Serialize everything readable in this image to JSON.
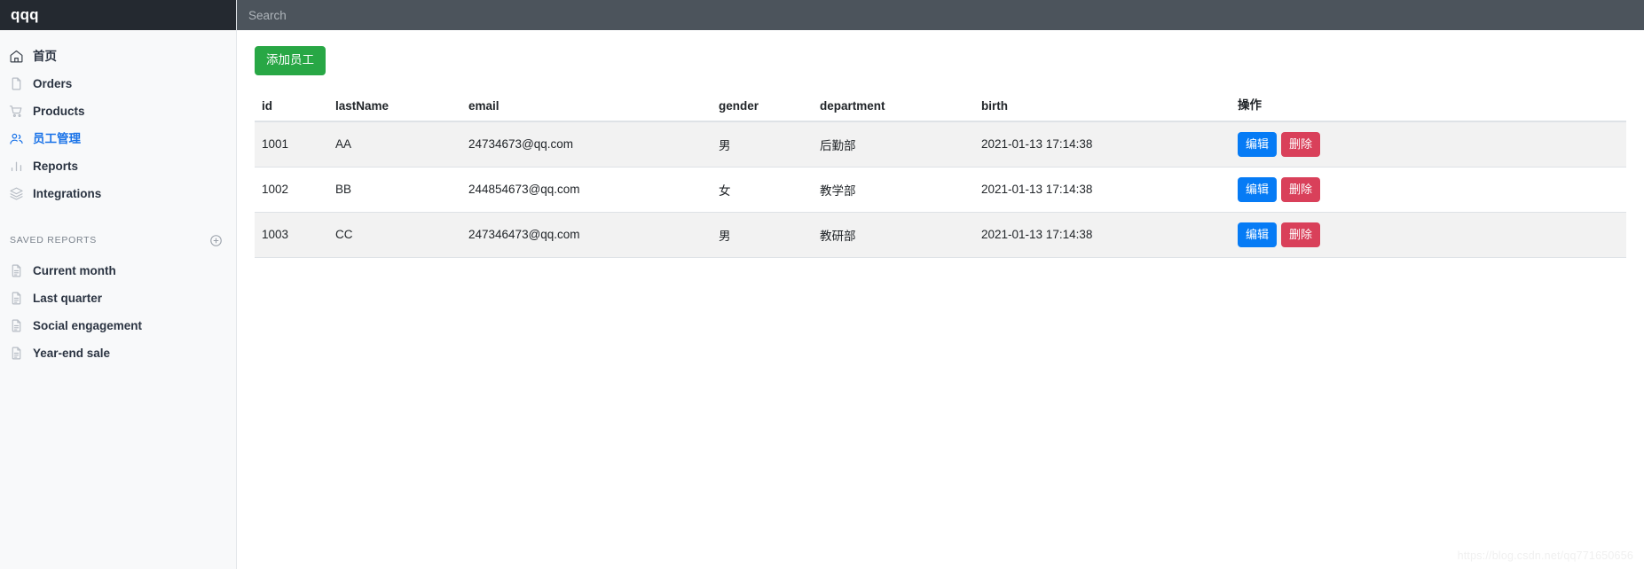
{
  "brand": {
    "title": "qqq"
  },
  "topbar": {
    "search_placeholder": "Search",
    "search_value": ""
  },
  "sidebar": {
    "nav": [
      {
        "label": "首页",
        "icon": "home-icon",
        "active": false
      },
      {
        "label": "Orders",
        "icon": "file-icon",
        "active": false
      },
      {
        "label": "Products",
        "icon": "cart-icon",
        "active": false
      },
      {
        "label": "员工管理",
        "icon": "users-icon",
        "active": true
      },
      {
        "label": "Reports",
        "icon": "bar-chart-icon",
        "active": false
      },
      {
        "label": "Integrations",
        "icon": "layers-icon",
        "active": false
      }
    ],
    "saved_reports": {
      "title": "SAVED REPORTS",
      "add_icon": "plus-circle-icon",
      "items": [
        {
          "label": "Current month",
          "icon": "document-icon"
        },
        {
          "label": "Last quarter",
          "icon": "document-icon"
        },
        {
          "label": "Social engagement",
          "icon": "document-icon"
        },
        {
          "label": "Year-end sale",
          "icon": "document-icon"
        }
      ]
    }
  },
  "main": {
    "add_button_label": "添加员工",
    "table": {
      "columns": [
        "id",
        "lastName",
        "email",
        "gender",
        "department",
        "birth",
        "操作"
      ],
      "rows": [
        {
          "id": "1001",
          "lastName": "AA",
          "email": "24734673@qq.com",
          "gender": "男",
          "department": "后勤部",
          "birth": "2021-01-13 17:14:38",
          "edit_label": "编辑",
          "delete_label": "删除"
        },
        {
          "id": "1002",
          "lastName": "BB",
          "email": "244854673@qq.com",
          "gender": "女",
          "department": "教学部",
          "birth": "2021-01-13 17:14:38",
          "edit_label": "编辑",
          "delete_label": "删除"
        },
        {
          "id": "1003",
          "lastName": "CC",
          "email": "247346473@qq.com",
          "gender": "男",
          "department": "教研部",
          "birth": "2021-01-13 17:14:38",
          "edit_label": "编辑",
          "delete_label": "删除"
        }
      ]
    }
  },
  "watermark": {
    "text": "https://blog.csdn.net/qq771650656"
  },
  "colors": {
    "brand_bar": "#242930",
    "topbar": "#4c545c",
    "sidebar_bg": "#f8f9fa",
    "accent_active": "#1a73e8",
    "add_button": "#28a745",
    "edit_button": "#067bf5",
    "delete_button": "#d9405a",
    "row_stripe": "#f2f2f2"
  }
}
